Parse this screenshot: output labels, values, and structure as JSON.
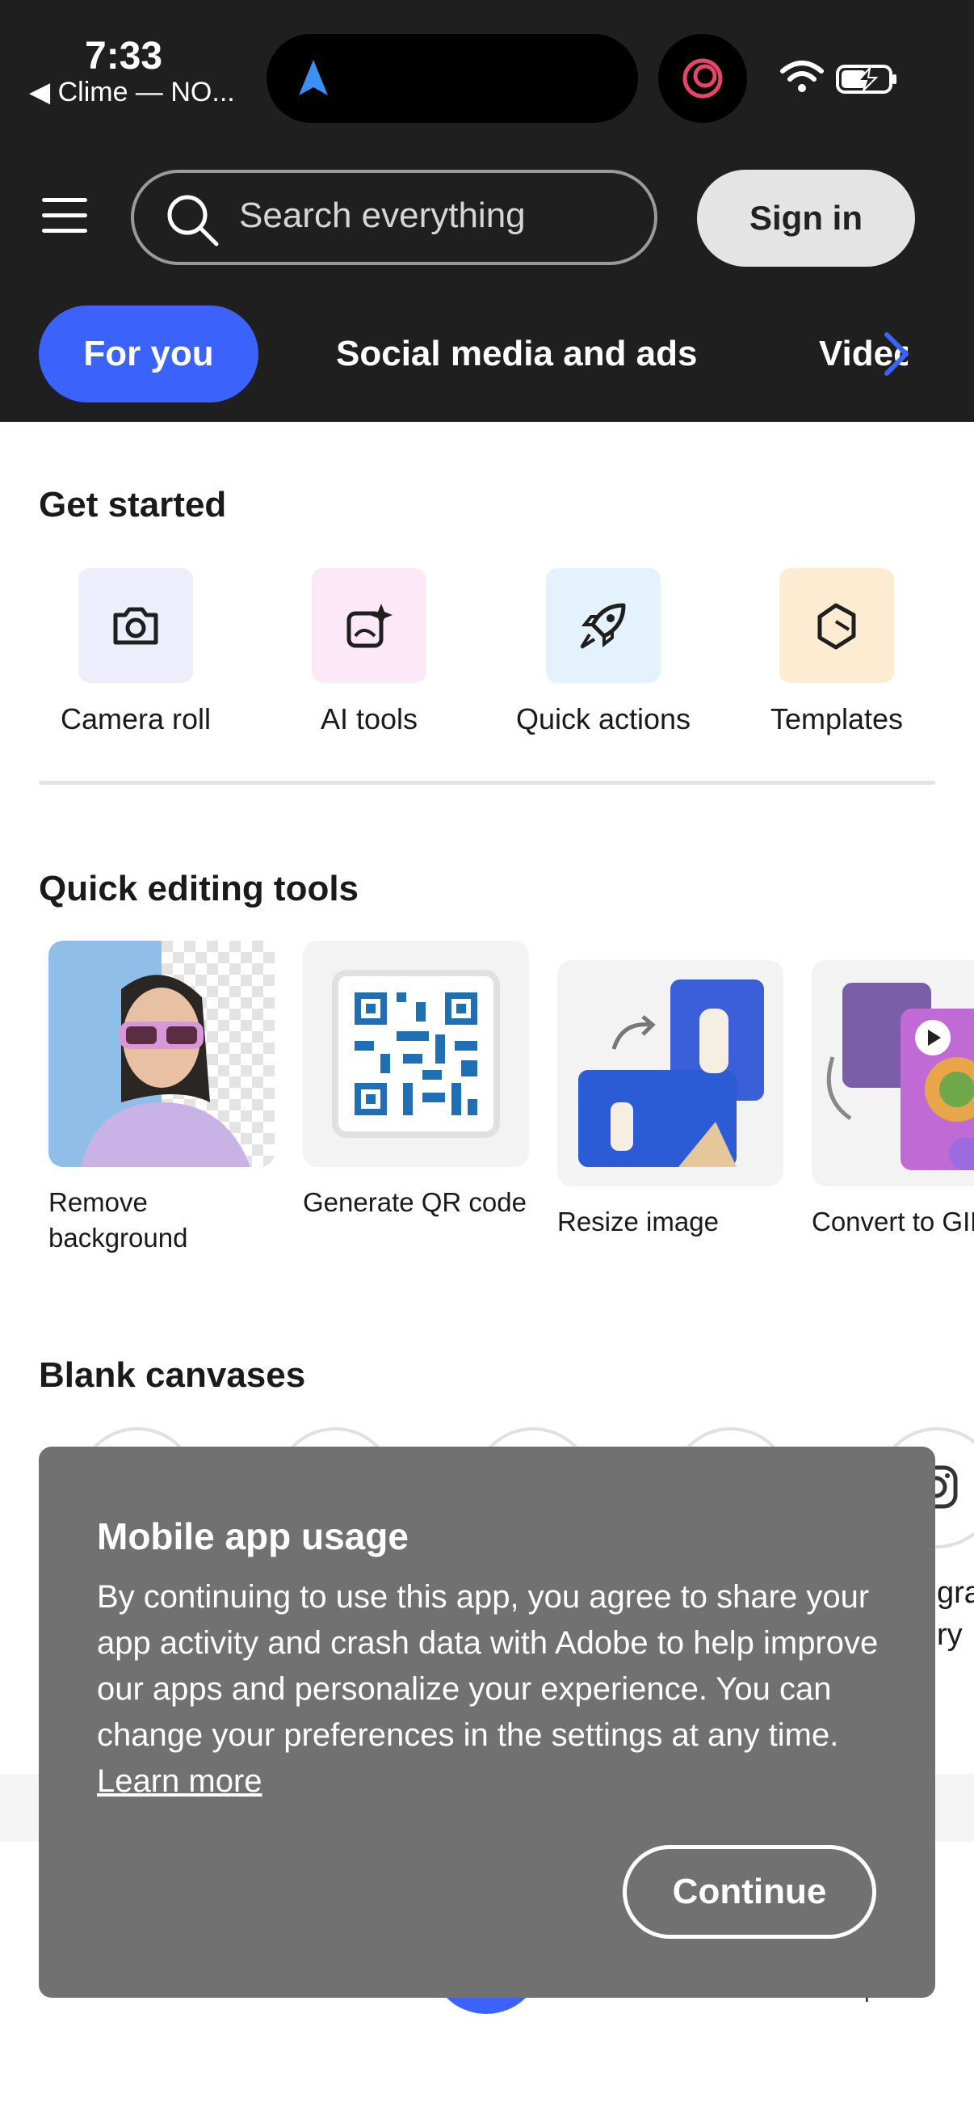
{
  "status": {
    "time": "7:33",
    "back_app": "◀ Clime — NO..."
  },
  "header": {
    "search_placeholder": "Search everything",
    "sign_in": "Sign in",
    "tabs": [
      "For you",
      "Social media and ads",
      "Video"
    ]
  },
  "get_started": {
    "title": "Get started",
    "items": [
      {
        "label": "Camera roll",
        "icon": "camera-icon",
        "tile_color": "#ededfc"
      },
      {
        "label": "AI tools",
        "icon": "sparkle-image-icon",
        "tile_color": "#fde8f8"
      },
      {
        "label": "Quick actions",
        "icon": "rocket-icon",
        "tile_color": "#e3f2fc"
      },
      {
        "label": "Templates",
        "icon": "template-icon",
        "tile_color": "#fdebd2"
      }
    ]
  },
  "quick_tools": {
    "title": "Quick editing tools",
    "items": [
      {
        "label": "Remove background"
      },
      {
        "label": "Generate QR code"
      },
      {
        "label": "Resize image"
      },
      {
        "label": "Convert to GIF"
      }
    ]
  },
  "blank_canvases": {
    "title": "Blank canvases",
    "partial_text_1": "gra",
    "partial_text_2": "ry"
  },
  "bottom_nav": {
    "partial_label": "plates"
  },
  "dialog": {
    "title": "Mobile app usage",
    "body": "By continuing to use this app, you agree to share your app activity and crash data with Adobe to help improve our apps and personalize your experience. You can change your preferences in the settings at any time.",
    "link": "Learn more",
    "button": "Continue"
  },
  "colors": {
    "accent": "#3b63fb",
    "header_bg": "#1f1f1f",
    "dialog_bg": "#717171"
  }
}
